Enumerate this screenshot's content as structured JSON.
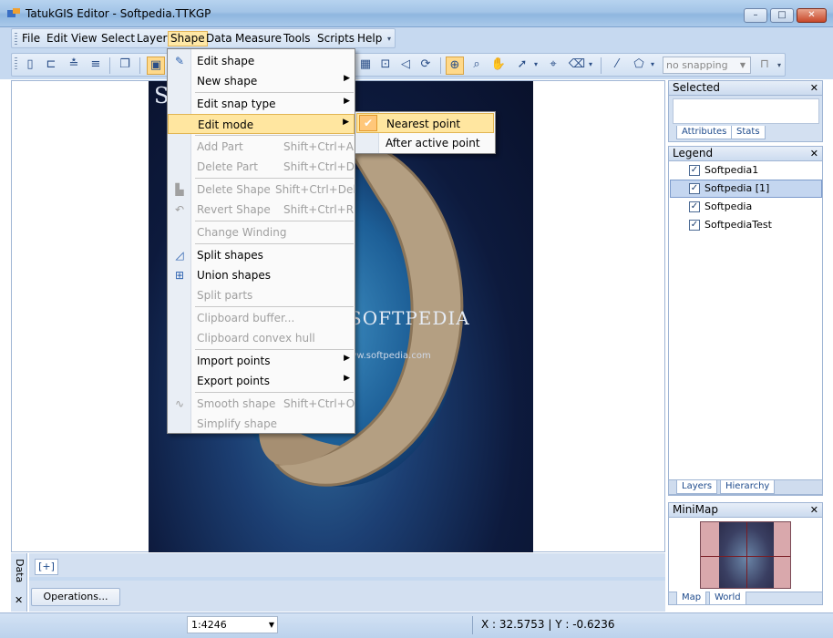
{
  "window": {
    "title": "TatukGIS Editor - Softpedia.TTKGP",
    "minimize": "–",
    "maximize": "□",
    "close": "✕"
  },
  "menubar": {
    "items": [
      {
        "label": "File",
        "underline": "F"
      },
      {
        "label": "Edit",
        "underline": "E"
      },
      {
        "label": "View",
        "underline": "V"
      },
      {
        "label": "Select",
        "underline": "S"
      },
      {
        "label": "Layer",
        "underline": "L"
      },
      {
        "label": "Shape",
        "underline": "S"
      },
      {
        "label": "Data",
        "underline": "D"
      },
      {
        "label": "Measure",
        "underline": "M"
      },
      {
        "label": "Tools",
        "underline": "T"
      },
      {
        "label": "Scripts",
        "underline": "S"
      },
      {
        "label": "Help",
        "underline": "H"
      }
    ],
    "active": "Shape"
  },
  "toolbar": {
    "snapping_value": "no snapping"
  },
  "shape_menu": {
    "items": [
      {
        "label": "Edit shape",
        "shortcut": "",
        "submenu": false,
        "disabled": false
      },
      {
        "label": "New shape",
        "shortcut": "",
        "submenu": true,
        "disabled": false
      },
      {
        "label": "Edit snap type",
        "shortcut": "",
        "submenu": true,
        "disabled": false
      },
      {
        "label": "Edit mode",
        "shortcut": "",
        "submenu": true,
        "disabled": false
      },
      {
        "label": "Add Part",
        "shortcut": "Shift+Ctrl+A",
        "submenu": false,
        "disabled": true
      },
      {
        "label": "Delete Part",
        "shortcut": "Shift+Ctrl+D",
        "submenu": false,
        "disabled": true
      },
      {
        "label": "Delete Shape",
        "shortcut": "Shift+Ctrl+Del",
        "submenu": false,
        "disabled": true
      },
      {
        "label": "Revert Shape",
        "shortcut": "Shift+Ctrl+R",
        "submenu": false,
        "disabled": true
      },
      {
        "label": "Change Winding",
        "shortcut": "",
        "submenu": false,
        "disabled": true
      },
      {
        "label": "Split shapes",
        "shortcut": "",
        "submenu": false,
        "disabled": false
      },
      {
        "label": "Union shapes",
        "shortcut": "",
        "submenu": false,
        "disabled": false
      },
      {
        "label": "Split parts",
        "shortcut": "",
        "submenu": false,
        "disabled": true
      },
      {
        "label": "Clipboard buffer...",
        "shortcut": "",
        "submenu": false,
        "disabled": true
      },
      {
        "label": "Clipboard convex hull",
        "shortcut": "",
        "submenu": false,
        "disabled": true
      },
      {
        "label": "Import points",
        "shortcut": "",
        "submenu": true,
        "disabled": false
      },
      {
        "label": "Export points",
        "shortcut": "",
        "submenu": true,
        "disabled": false
      },
      {
        "label": "Smooth shape",
        "shortcut": "Shift+Ctrl+O",
        "submenu": false,
        "disabled": true
      },
      {
        "label": "Simplify shape",
        "shortcut": "",
        "submenu": false,
        "disabled": true
      }
    ],
    "highlighted": "Edit mode"
  },
  "edit_mode_submenu": {
    "items": [
      {
        "label": "Nearest point",
        "checked": true
      },
      {
        "label": "After active point",
        "checked": false
      }
    ]
  },
  "map": {
    "text_softpedia": "SOFTPEDIA",
    "text_url": "www.softpedia.com",
    "text_top": "S"
  },
  "panels": {
    "selected": {
      "title": "Selected",
      "tabs": [
        "Attributes",
        "Stats"
      ]
    },
    "legend": {
      "title": "Legend",
      "layers": [
        {
          "name": "Softpedia1",
          "checked": true,
          "selected": false
        },
        {
          "name": "Softpedia [1]",
          "checked": true,
          "selected": true
        },
        {
          "name": "Softpedia",
          "checked": true,
          "selected": false
        },
        {
          "name": "SoftpediaTest",
          "checked": true,
          "selected": false
        }
      ],
      "tabs": [
        "Layers",
        "Hierarchy"
      ]
    },
    "minimap": {
      "title": "MiniMap",
      "tabs": [
        "Map",
        "World"
      ]
    },
    "close_glyph": "✕"
  },
  "bottom": {
    "data_tab": "Data",
    "close_glyph": "✕",
    "add_tab": "[+]",
    "operations_button": "Operations..."
  },
  "statusbar": {
    "scale": "1:4246",
    "coordinates": "X : 32.5753 | Y : -0.6236"
  }
}
